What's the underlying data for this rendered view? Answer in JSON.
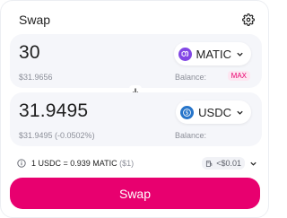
{
  "header": {
    "title": "Swap",
    "settings_icon": "gear-icon"
  },
  "input_panel": {
    "amount": "30",
    "token": "MATIC",
    "token_icon": "matic-token-icon",
    "token_color": "#8247e5",
    "usd_value": "$31.9656",
    "balance_label": "Balance:",
    "max_label": "MAX"
  },
  "output_panel": {
    "amount": "31.9495",
    "token": "USDC",
    "token_icon": "usdc-token-icon",
    "token_color": "#2775ca",
    "usd_value": "$31.9495 (-0.0502%)",
    "balance_label": "Balance:"
  },
  "flip_icon": "arrow-down-icon",
  "rate": {
    "text": "1 USDC = 0.939 MATIC",
    "usd": "($1)",
    "info_icon": "info-icon"
  },
  "gas": {
    "icon": "gas-pump-icon",
    "text": "<$0.01"
  },
  "swap_button": {
    "label": "Swap"
  },
  "colors": {
    "accent": "#e8006f",
    "panel_bg": "#f5f6fa"
  }
}
